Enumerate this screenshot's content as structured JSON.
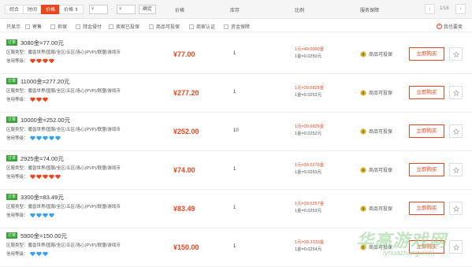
{
  "toolbar": {
    "sort_tabs": [
      "综合",
      "时间",
      "价格",
      "价格 ⇕"
    ],
    "active_tab": 2,
    "price_from": "¥",
    "dash": "-",
    "price_to": "¥",
    "confirm": "确定",
    "col_price": "价格",
    "col_stock": "库存",
    "col_ratio": "比例",
    "col_guarantee": "服务保障",
    "page_indicator": "1/16",
    "prev": "‹",
    "next": "›"
  },
  "filter": {
    "label": "只显示",
    "options": [
      "寄售",
      "担保",
      "拜金侵付",
      "卖家已投保",
      "商品可投保",
      "商家认证",
      "资金保障"
    ],
    "collect": "我也要卖"
  },
  "row_common": {
    "tag": "订单",
    "region_prefix": "区服类型：",
    "region": "魔兽世界/国服/全区/五区/洛心(PVP)/联盟/游戏币",
    "credit_label": "信用等级：",
    "guarantee": "商品可投保",
    "buy": "立即购买"
  },
  "listings": [
    {
      "title": "3080金=77.00元",
      "price": "¥77.00",
      "stock": "1",
      "ratio1": "1元=40.0000金",
      "ratio2": "1金=0.0250元",
      "hearts": 4,
      "heart_type": "red"
    },
    {
      "title": "11000金=277.20元",
      "price": "¥277.20",
      "stock": "1",
      "ratio1": "1元=39.6825金",
      "ratio2": "1金=0.0252元",
      "hearts": 3,
      "heart_type": "red"
    },
    {
      "title": "10000金=252.00元",
      "price": "¥252.00",
      "stock": "10",
      "ratio1": "1元=39.6825金",
      "ratio2": "1金=0.0252元",
      "hearts": 5,
      "heart_type": "blue"
    },
    {
      "title": "2925金=74.00元",
      "price": "¥74.00",
      "stock": "1",
      "ratio1": "1元=39.5270金",
      "ratio2": "1金=0.0253元",
      "hearts": 5,
      "heart_type": "red"
    },
    {
      "title": "3300金=83.49元",
      "price": "¥83.49",
      "stock": "1",
      "ratio1": "1元=39.5257金",
      "ratio2": "1金=0.0253元",
      "hearts": 4,
      "heart_type": "blue"
    },
    {
      "title": "5900金=150.00元",
      "price": "¥150.00",
      "stock": "1",
      "ratio1": "1元=39.3333金",
      "ratio2": "1金=0.0254元",
      "hearts": 3,
      "heart_type": "blue"
    }
  ],
  "watermark": {
    "main": "华高游戏网",
    "sub": "lyhuazhang.com"
  },
  "colors": {
    "accent": "#e8461c",
    "red_heart": "#e8461c",
    "blue_heart": "#3aa2e8",
    "tag_green": "#3aa43a"
  }
}
